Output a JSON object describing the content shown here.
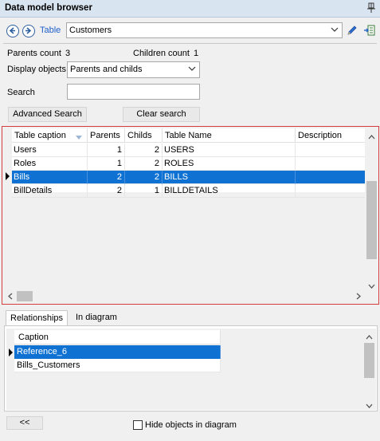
{
  "window": {
    "title": "Data model browser"
  },
  "toolbar": {
    "table_link": "Table",
    "table_value": "Customers"
  },
  "counts": {
    "parents_label": "Parents count",
    "parents_value": "3",
    "children_label": "Children count",
    "children_value": "1"
  },
  "display": {
    "label": "Display objects",
    "value": "Parents and childs"
  },
  "search": {
    "label": "Search",
    "value": "",
    "advanced_label": "Advanced Search",
    "clear_label": "Clear search"
  },
  "table": {
    "columns": [
      "Table caption",
      "Parents",
      "Childs",
      "Table Name",
      "Description"
    ],
    "rows": [
      {
        "caption": "Users",
        "parents": "1",
        "childs": "2",
        "name": "USERS",
        "description": ""
      },
      {
        "caption": "Roles",
        "parents": "1",
        "childs": "2",
        "name": "ROLES",
        "description": ""
      },
      {
        "caption": "Bills",
        "parents": "2",
        "childs": "2",
        "name": "BILLS",
        "description": ""
      },
      {
        "caption": "BillDetails",
        "parents": "2",
        "childs": "1",
        "name": "BILLDETAILS",
        "description": ""
      }
    ],
    "selected_row": "Bills"
  },
  "tabs": [
    {
      "label": "Relationships",
      "active": true
    },
    {
      "label": "In diagram",
      "active": false
    }
  ],
  "relationships": {
    "column": "Caption",
    "rows": [
      "Reference_6",
      "Bills_Customers"
    ],
    "selected_row": "Reference_6"
  },
  "footer": {
    "collapse_label": "<<",
    "hide_label": "Hide objects in diagram",
    "hide_checked": false
  },
  "colors": {
    "selection": "#0f72d3",
    "grid_frame": "#d43d3d",
    "titlebar": "#d9e4f1",
    "link": "#1c5fc8"
  },
  "icons": [
    "pin-icon",
    "back-icon",
    "forward-icon",
    "edit-pencil-icon",
    "export-icon",
    "chevron-down-icon",
    "filter-arrow-icon",
    "row-marker-icon"
  ]
}
